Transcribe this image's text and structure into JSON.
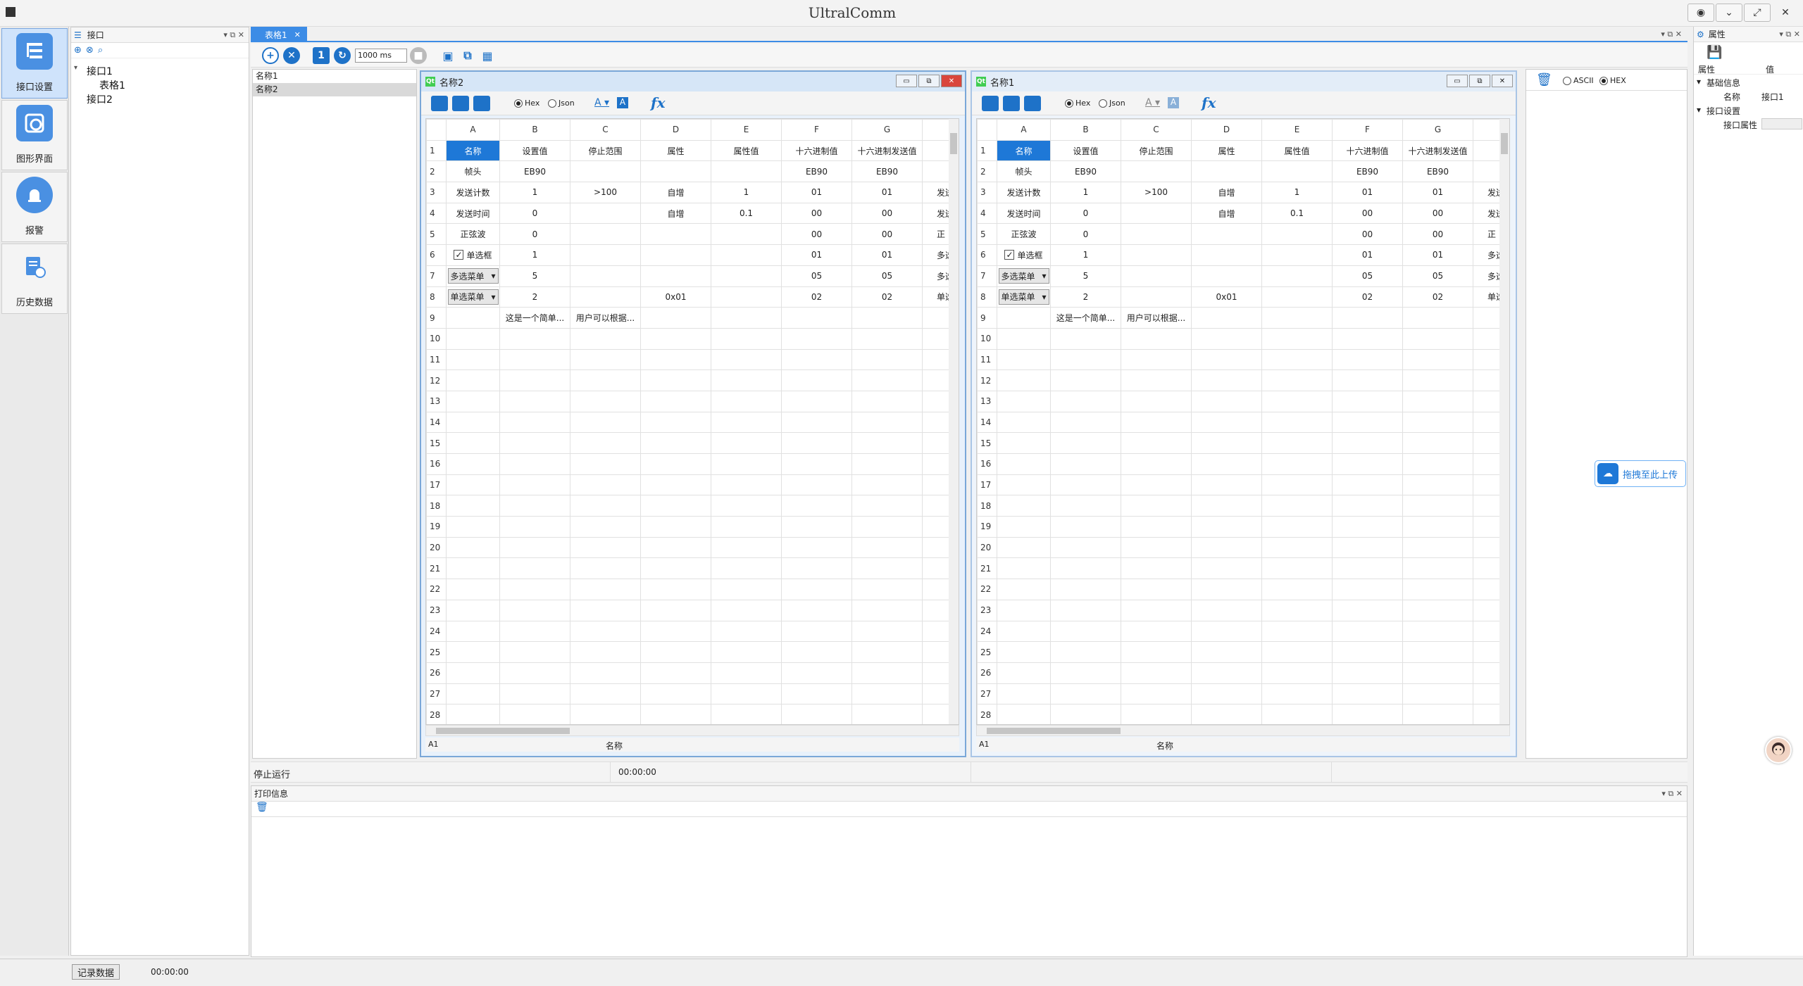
{
  "app": {
    "title": "UltralComm"
  },
  "leftnav": [
    {
      "label": "接口设置"
    },
    {
      "label": "图形界面"
    },
    {
      "label": "报警"
    },
    {
      "label": "历史数据"
    }
  ],
  "tree": {
    "header": "接口",
    "items": [
      {
        "label": "接口1"
      },
      {
        "label": "表格1"
      },
      {
        "label": "接口2"
      }
    ]
  },
  "maintab": {
    "label": "表格1"
  },
  "toolbar": {
    "interval": "1000 ms"
  },
  "namelist": [
    "名称1",
    "名称2"
  ],
  "windows": [
    {
      "title": "名称2"
    },
    {
      "title": "名称1"
    }
  ],
  "sheet_toolbar": {
    "radio_hex": "Hex",
    "radio_json": "Json"
  },
  "sheet": {
    "columns": [
      "A",
      "B",
      "C",
      "D",
      "E",
      "F",
      "G"
    ],
    "header_row": [
      "名称",
      "设置值",
      "停止范围",
      "属性",
      "属性值",
      "十六进制值",
      "十六进制发送值"
    ],
    "rows": [
      [
        "帧头",
        "EB90",
        "",
        "",
        "",
        "EB90",
        "EB90"
      ],
      [
        "发送计数",
        "1",
        ">100",
        "自增",
        "1",
        "01",
        "01"
      ],
      [
        "发送时间",
        "0",
        "",
        "自增",
        "0.1",
        "00",
        "00"
      ],
      [
        "正弦波",
        "0",
        "",
        "",
        "",
        "00",
        "00"
      ],
      [
        "单选框",
        "1",
        "",
        "",
        "",
        "01",
        "01"
      ],
      [
        "多选菜单",
        "5",
        "",
        "",
        "",
        "05",
        "05"
      ],
      [
        "单选菜单",
        "2",
        "",
        "0x01",
        "",
        "02",
        "02"
      ],
      [
        "",
        "这是一个简单...",
        "用户可以根据...",
        "",
        "",
        "",
        ""
      ]
    ],
    "extra_col": [
      "",
      "",
      "发送",
      "发送",
      "正",
      "多选",
      "多选",
      "单选",
      ""
    ],
    "row_count": 28,
    "status_cell": "A1",
    "status_value": "名称"
  },
  "datapanel": {
    "radio_ascii": "ASCII",
    "radio_hex": "HEX"
  },
  "props": {
    "header": "属性",
    "col_name": "属性",
    "col_value": "值",
    "group1": "基础信息",
    "name_label": "名称",
    "name_value": "接口1",
    "group2": "接口设置",
    "iface_label": "接口属性"
  },
  "upload": {
    "label": "拖拽至此上传"
  },
  "runstatus": {
    "state": "停止运行",
    "time": "00:00:00"
  },
  "print": {
    "header": "打印信息"
  },
  "bottom": {
    "record_button": "记录数据",
    "time": "00:00:00"
  }
}
